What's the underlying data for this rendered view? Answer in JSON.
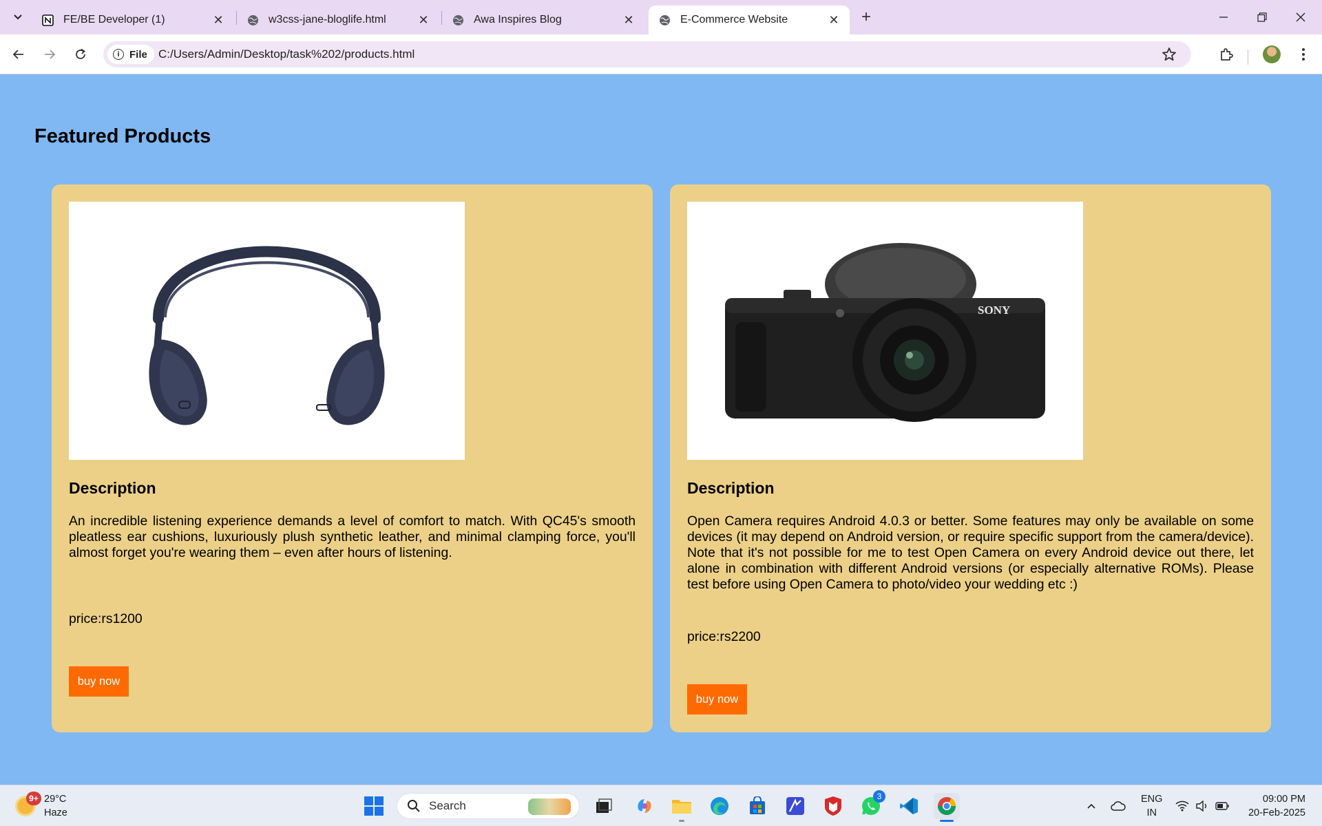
{
  "browser": {
    "tabs": [
      {
        "title": "FE/BE Developer (1)",
        "icon": "notion-icon",
        "active": false
      },
      {
        "title": "w3css-jane-bloglife.html",
        "icon": "globe-icon",
        "active": false
      },
      {
        "title": "Awa Inspires Blog",
        "icon": "globe-icon",
        "active": false
      },
      {
        "title": "E-Commerce Website",
        "icon": "globe-icon",
        "active": true
      }
    ],
    "address": {
      "chip_label": "File",
      "url": "C:/Users/Admin/Desktop/task%202/products.html"
    }
  },
  "page": {
    "heading": "Featured Products",
    "products": [
      {
        "image": "headphones",
        "description_title": "Description",
        "description": "An incredible listening experience demands a level of comfort to match. With QC45's smooth pleatless ear cushions, luxuriously plush synthetic leather, and minimal clamping force, you'll almost forget you're wearing them – even after hours of listening.",
        "price": "price:rs1200",
        "button": "buy now"
      },
      {
        "image": "camera",
        "brand_on_image": "SONY",
        "description_title": "Description",
        "description": "Open Camera requires Android 4.0.3 or better. Some features may only be available on some devices (it may depend on Android version, or require specific support from the camera/device). Note that it's not possible for me to test Open Camera on every Android device out there, let alone in combination with different Android versions (or especially alternative ROMs). Please test before using Open Camera to photo/video your wedding etc :)",
        "price": "price:rs2200",
        "button": "buy now"
      }
    ],
    "colors": {
      "background": "#7fb8f2",
      "card": "#ecd088",
      "button": "#ff6a00"
    }
  },
  "taskbar": {
    "weather": {
      "temp": "29°C",
      "condition": "Haze",
      "badge": "9+"
    },
    "search_label": "Search",
    "whatsapp_badge": "3",
    "lang": {
      "line1": "ENG",
      "line2": "IN"
    },
    "clock": {
      "time": "09:00 PM",
      "date": "20-Feb-2025"
    }
  }
}
